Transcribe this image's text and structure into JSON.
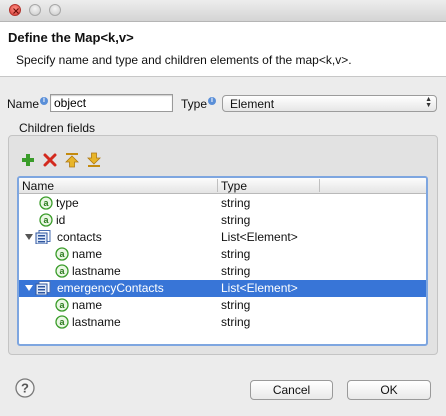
{
  "window": {
    "controls": [
      "close",
      "minimize",
      "maximize"
    ]
  },
  "header": {
    "title": "Define the Map<k,v>",
    "description": "Specify name and type and children elements of the map<k,v>."
  },
  "form": {
    "name_label": "Name",
    "name_info_icon": "info-icon",
    "name_value": "object",
    "type_label": "Type",
    "type_info_icon": "info-icon",
    "type_value": "Element"
  },
  "children": {
    "group_label": "Children fields",
    "toolbar": [
      {
        "id": "add",
        "icon": "add-icon",
        "color": "#3a9c2a"
      },
      {
        "id": "remove",
        "icon": "remove-icon",
        "color": "#d32a1e"
      },
      {
        "id": "move-up",
        "icon": "move-up-icon",
        "color": "#e8b52a"
      },
      {
        "id": "move-down",
        "icon": "move-down-icon",
        "color": "#e8b52a"
      }
    ],
    "columns": [
      "Name",
      "Type"
    ],
    "rows": [
      {
        "name": "type",
        "type": "string",
        "kind": "attribute",
        "level": 1
      },
      {
        "name": "id",
        "type": "string",
        "kind": "attribute",
        "level": 1
      },
      {
        "name": "contacts",
        "type": "List<Element>",
        "kind": "list",
        "level": 0,
        "expanded": true
      },
      {
        "name": "name",
        "type": "string",
        "kind": "attribute",
        "level": 2
      },
      {
        "name": "lastname",
        "type": "string",
        "kind": "attribute",
        "level": 2
      },
      {
        "name": "emergencyContacts",
        "type": "List<Element>",
        "kind": "list",
        "level": 0,
        "expanded": true,
        "selected": true
      },
      {
        "name": "name",
        "type": "string",
        "kind": "attribute",
        "level": 2
      },
      {
        "name": "lastname",
        "type": "string",
        "kind": "attribute",
        "level": 2
      }
    ]
  },
  "footer": {
    "help_icon": "help-icon",
    "cancel_label": "Cancel",
    "ok_label": "OK"
  },
  "colors": {
    "selection": "#3875d7",
    "tree_border": "#7ea6e0",
    "attribute_icon": "#3a9c2a"
  }
}
